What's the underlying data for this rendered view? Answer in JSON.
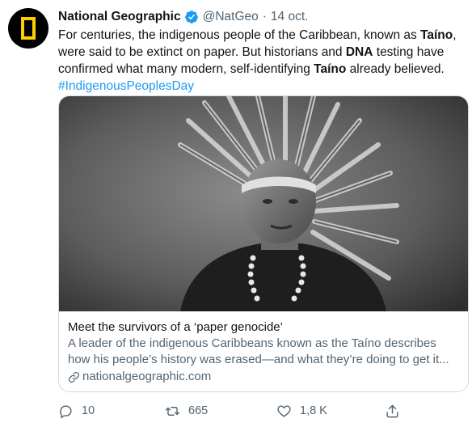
{
  "tweet": {
    "author_name": "National Geographic",
    "author_handle": "@NatGeo",
    "separator": "·",
    "date": "14 oct.",
    "text_lines": [
      [
        "For centuries, the indigenous people of the Caribbean, known as ",
        "Taíno",
        ","
      ],
      [
        "were said to be extinct on paper. But historians and ",
        "DNA",
        " testing have"
      ],
      [
        "confirmed what many modern, self-identifying ",
        "Taíno",
        " already believed."
      ]
    ],
    "hashtag": "#IndigenousPeoplesDay"
  },
  "card": {
    "title": "Meet the survivors of a ‘paper genocide’",
    "description_line1": "A leader of the indigenous Caribbeans known as the Taíno describes",
    "description_line2": "how his people’s history was erased—and what they’re doing to get it...",
    "link": "nationalgeographic.com"
  },
  "actions": {
    "replies": "10",
    "retweets": "665",
    "likes": "1,8 K"
  },
  "colors": {
    "hashtag": "#1d9bf0",
    "verified": "#1d9bf0",
    "avatar_bg": "#000000",
    "brand_yellow": "#ffce00",
    "muted": "#536471"
  },
  "icons": [
    "natgeo-logo-icon",
    "verified-badge-icon",
    "link-icon",
    "reply-icon",
    "retweet-icon",
    "like-icon",
    "share-icon"
  ]
}
